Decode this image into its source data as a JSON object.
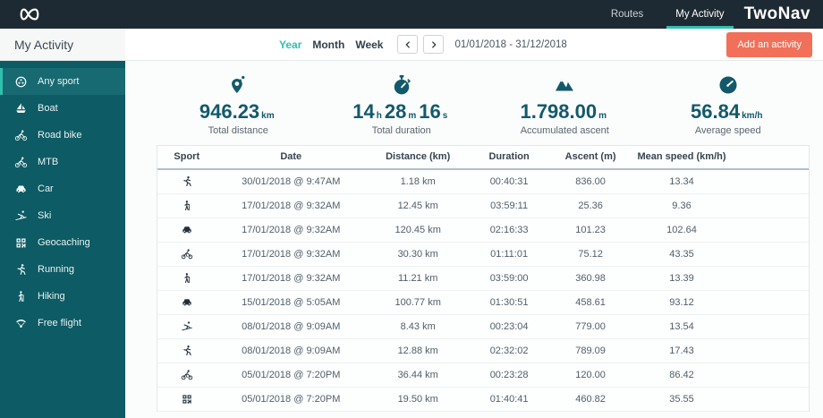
{
  "colors": {
    "topbar": "#1e2a33",
    "sidebar": "#0d5b64",
    "sidebar_selected": "#186a72",
    "accent": "#2fc0b0",
    "button": "#f27059",
    "stat_text": "#12596b"
  },
  "brand": {
    "wordmark": "TwoNav"
  },
  "topnav": {
    "items": [
      {
        "label": "Routes",
        "active": false
      },
      {
        "label": "My Activity",
        "active": true
      }
    ]
  },
  "sidebar": {
    "title": "My Activity",
    "items": [
      {
        "label": "Any sport",
        "icon": "anysport",
        "active": true
      },
      {
        "label": "Boat",
        "icon": "boat",
        "active": false
      },
      {
        "label": "Road bike",
        "icon": "bike",
        "active": false
      },
      {
        "label": "MTB",
        "icon": "bike",
        "active": false
      },
      {
        "label": "Car",
        "icon": "car",
        "active": false
      },
      {
        "label": "Ski",
        "icon": "ski",
        "active": false
      },
      {
        "label": "Geocaching",
        "icon": "geocaching",
        "active": false
      },
      {
        "label": "Running",
        "icon": "running",
        "active": false
      },
      {
        "label": "Hiking",
        "icon": "hiking",
        "active": false
      },
      {
        "label": "Free flight",
        "icon": "freeflight",
        "active": false
      }
    ]
  },
  "toolbar": {
    "periods": [
      {
        "label": "Year",
        "active": true
      },
      {
        "label": "Month",
        "active": false
      },
      {
        "label": "Week",
        "active": false
      }
    ],
    "date_range": "01/01/2018 - 31/12/2018",
    "add_button_label": "Add an activity"
  },
  "stats": [
    {
      "icon": "pin",
      "label": "Total distance",
      "parts": [
        {
          "v": "946.23",
          "u": "km"
        }
      ]
    },
    {
      "icon": "stopwatch",
      "label": "Total duration",
      "parts": [
        {
          "v": "14",
          "u": "h"
        },
        {
          "v": "28",
          "u": "m"
        },
        {
          "v": "16",
          "u": "s"
        }
      ]
    },
    {
      "icon": "mountain",
      "label": "Accumulated ascent",
      "parts": [
        {
          "v": "1.798.00",
          "u": "m"
        }
      ]
    },
    {
      "icon": "speedometer",
      "label": "Average speed",
      "parts": [
        {
          "v": "56.84",
          "u": "km/h"
        }
      ]
    }
  ],
  "table": {
    "columns": [
      "Sport",
      "Date",
      "Distance (km)",
      "Duration",
      "Ascent (m)",
      "Mean speed (km/h)"
    ],
    "rows": [
      {
        "sport": "running",
        "date": "30/01/2018 @ 9:47AM",
        "distance": "1.18 km",
        "duration": "00:40:31",
        "ascent": "836.00",
        "mean_speed": "13.34"
      },
      {
        "sport": "hiking",
        "date": "17/01/2018 @ 9:32AM",
        "distance": "12.45 km",
        "duration": "03:59:11",
        "ascent": "25.36",
        "mean_speed": "9.36"
      },
      {
        "sport": "car",
        "date": "17/01/2018 @ 9:32AM",
        "distance": "120.45 km",
        "duration": "02:16:33",
        "ascent": "101.23",
        "mean_speed": "102.64"
      },
      {
        "sport": "bike",
        "date": "17/01/2018 @ 9:32AM",
        "distance": "30.30 km",
        "duration": "01:11:01",
        "ascent": "75.12",
        "mean_speed": "43.35"
      },
      {
        "sport": "hiking",
        "date": "17/01/2018 @ 9:32AM",
        "distance": "11.21 km",
        "duration": "03:59:00",
        "ascent": "360.98",
        "mean_speed": "13.39"
      },
      {
        "sport": "car",
        "date": "15/01/2018 @ 5:05AM",
        "distance": "100.77 km",
        "duration": "01:30:51",
        "ascent": "458.61",
        "mean_speed": "93.12"
      },
      {
        "sport": "ski",
        "date": "08/01/2018 @ 9:09AM",
        "distance": "8.43 km",
        "duration": "00:23:04",
        "ascent": "779.00",
        "mean_speed": "13.54"
      },
      {
        "sport": "running",
        "date": "08/01/2018 @ 9:09AM",
        "distance": "12.88 km",
        "duration": "02:32:02",
        "ascent": "789.09",
        "mean_speed": "17.43"
      },
      {
        "sport": "bike",
        "date": "05/01/2018 @ 7:20PM",
        "distance": "36.44 km",
        "duration": "00:23:28",
        "ascent": "120.00",
        "mean_speed": "86.42"
      },
      {
        "sport": "geocaching",
        "date": "05/01/2018 @ 7:20PM",
        "distance": "19.50 km",
        "duration": "01:40:41",
        "ascent": "460.82",
        "mean_speed": "35.55"
      }
    ]
  }
}
